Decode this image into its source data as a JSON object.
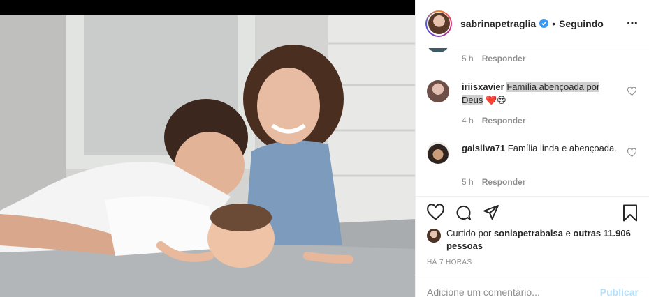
{
  "post": {
    "username": "sabrinapetraglia",
    "dot": "•",
    "follow_status": "Seguindo",
    "more_icon": "⋯"
  },
  "comments": [
    {
      "time": "5 h",
      "reply": "Responder"
    },
    {
      "user": "iriisxavier",
      "text": "Família abençoada por Deus",
      "emoji": "❤️😍",
      "time": "4 h",
      "reply": "Responder"
    },
    {
      "user": "galsilva71",
      "text": "Família linda e abençoada.",
      "time": "5 h",
      "reply": "Responder"
    }
  ],
  "likes": {
    "prefix": "Curtido por",
    "liker": "soniapetrabalsa",
    "conj": "e",
    "others": "outras 11.906 pessoas"
  },
  "post_time": "HÁ 7 HORAS",
  "comment_box": {
    "placeholder": "Adicione um comentário...",
    "publish_label": "Publicar"
  },
  "colors": {
    "verified": "#3897f0",
    "publish_disabled": "#b2dffc",
    "heart_red": "#ed4956"
  },
  "icons": [
    "heart-icon",
    "comment-icon",
    "share-icon",
    "bookmark-icon",
    "verified-badge-icon",
    "more-options-icon"
  ]
}
